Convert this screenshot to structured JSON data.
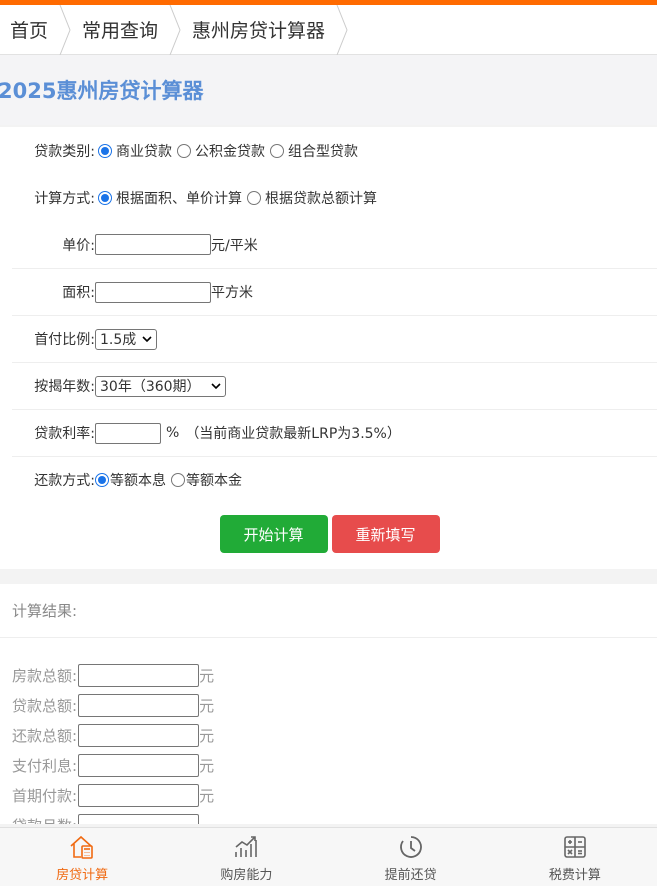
{
  "breadcrumb": [
    "首页",
    "常用查询",
    "惠州房贷计算器"
  ],
  "page_title": "2025惠州房贷计算器",
  "form": {
    "loan_type": {
      "label": "贷款类别:",
      "options": [
        "商业贷款",
        "公积金贷款",
        "组合型贷款"
      ],
      "selected": 0
    },
    "calc_method": {
      "label": "计算方式:",
      "options": [
        "根据面积、单价计算",
        "根据贷款总额计算"
      ],
      "selected": 0
    },
    "unit_price": {
      "label": "单价:",
      "value": "",
      "unit": "元/平米"
    },
    "area": {
      "label": "面积:",
      "value": "",
      "unit": "平方米"
    },
    "down_payment": {
      "label": "首付比例:",
      "value": "1.5成"
    },
    "years": {
      "label": "按揭年数:",
      "value": "30年（360期）"
    },
    "rate": {
      "label": "贷款利率:",
      "value": "",
      "unit": "%",
      "note": "（当前商业贷款最新LRP为3.5%）"
    },
    "repay_method": {
      "label": "还款方式:",
      "options": [
        "等额本息",
        "等额本金"
      ],
      "selected": 0
    },
    "calc_button": "开始计算",
    "reset_button": "重新填写"
  },
  "result": {
    "heading": "计算结果:",
    "rows": [
      {
        "label": "房款总额:",
        "unit": "元"
      },
      {
        "label": "贷款总额:",
        "unit": "元"
      },
      {
        "label": "还款总额:",
        "unit": "元"
      },
      {
        "label": "支付利息:",
        "unit": "元"
      },
      {
        "label": "首期付款:",
        "unit": "元"
      },
      {
        "label": "贷款月数:",
        "unit": ""
      }
    ]
  },
  "tabs": [
    {
      "label": "房贷计算",
      "icon": "house-calculator-icon",
      "active": true
    },
    {
      "label": "购房能力",
      "icon": "bar-chart-icon",
      "active": false
    },
    {
      "label": "提前还贷",
      "icon": "clock-icon",
      "active": false
    },
    {
      "label": "税费计算",
      "icon": "calculator-icon",
      "active": false
    }
  ],
  "colors": {
    "accent": "#ff6a00",
    "title": "#5b8fd6",
    "calc_button": "#21ab37",
    "reset_button": "#e74c4c",
    "active_tab": "#f06a12"
  }
}
